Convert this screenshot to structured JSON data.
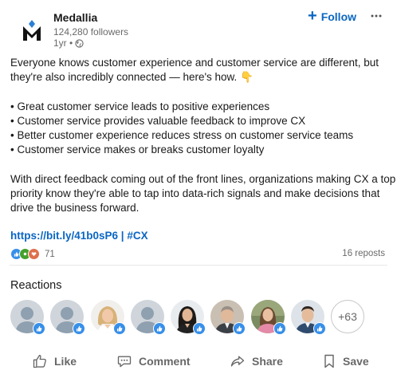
{
  "post": {
    "company": "Medallia",
    "followers": "124,280 followers",
    "age": "1yr •",
    "follow_label": "Follow",
    "text_intro_1": "Everyone knows customer experience and customer service are different, but",
    "text_intro_2": "they're also incredibly connected — here's how. 👇",
    "bullets": [
      "• Great customer service leads to positive experiences",
      "• Customer service provides valuable feedback to improve CX",
      "• Better customer experience reduces stress on customer service teams",
      "• Customer service makes or breaks customer loyalty"
    ],
    "closing_1": "With direct feedback coming out of the front lines, organizations making CX a top",
    "closing_2": "priority know they're able to tap into data-rich signals and make decisions that",
    "closing_3": "drive the business forward.",
    "link": "https://bit.ly/41b0sP6",
    "link_sep": " | ",
    "hashtag": "#CX"
  },
  "social": {
    "reaction_count": "71",
    "reposts": "16 reposts"
  },
  "reactions": {
    "title": "Reactions",
    "more": "+63"
  },
  "actions": {
    "like": "Like",
    "comment": "Comment",
    "share": "Share",
    "save": "Save"
  },
  "colors": {
    "brand_blue": "#0a66c2",
    "like_badge": "#378fe9"
  }
}
